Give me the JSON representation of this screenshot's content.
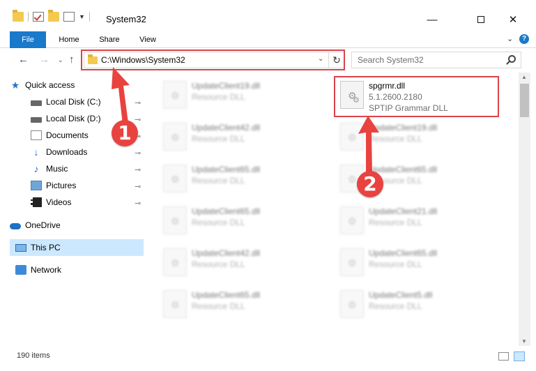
{
  "window": {
    "title": "System32",
    "minimize_glyph": "—",
    "close_glyph": "✕"
  },
  "ribbon": {
    "tabs": [
      "File",
      "Home",
      "Share",
      "View"
    ],
    "expand_glyph": "⌄",
    "help_glyph": "?"
  },
  "address": {
    "path": "C:\\Windows\\System32",
    "dropdown_glyph": "⌄",
    "refresh_glyph": "↻"
  },
  "search": {
    "placeholder": "Search System32"
  },
  "nav": {
    "back_glyph": "←",
    "forward_glyph": "→",
    "recent_glyph": "⌄",
    "up_glyph": "↑"
  },
  "sidebar": {
    "quick_access": "Quick access",
    "items": [
      {
        "label": "Local Disk (C:)",
        "icon": "disk-icon"
      },
      {
        "label": "Local Disk (D:)",
        "icon": "disk-icon"
      },
      {
        "label": "Documents",
        "icon": "documents-icon"
      },
      {
        "label": "Downloads",
        "icon": "download-icon"
      },
      {
        "label": "Music",
        "icon": "music-icon"
      },
      {
        "label": "Pictures",
        "icon": "pictures-icon"
      },
      {
        "label": "Videos",
        "icon": "videos-icon"
      }
    ],
    "onedrive": "OneDrive",
    "this_pc": "This PC",
    "network": "Network",
    "pin_glyph": "📌"
  },
  "files": {
    "highlighted": {
      "name": "spgrmr.dll",
      "version": "5.1.2600.2180",
      "description": "SPTIP Grammar DLL"
    },
    "col1": [
      {
        "name": "UpdateClient19.dll",
        "desc": "Resource DLL"
      },
      {
        "name": "UpdateClient42.dll",
        "desc": "Resource DLL"
      },
      {
        "name": "UpdateClient65.dll",
        "desc": "Resource DLL"
      },
      {
        "name": "UpdateClient65.dll",
        "desc": "Resource DLL"
      },
      {
        "name": "UpdateClient42.dll",
        "desc": "Resource DLL"
      },
      {
        "name": "UpdateClient65.dll",
        "desc": "Resource DLL"
      }
    ],
    "col2": [
      {
        "name": "UpdateClient19.dll",
        "desc": "Resource DLL"
      },
      {
        "name": "UpdateClient65.dll",
        "desc": "Resource DLL"
      },
      {
        "name": "UpdateClient21.dll",
        "desc": "Resource DLL"
      },
      {
        "name": "UpdateClient65.dll",
        "desc": "Resource DLL"
      },
      {
        "name": "UpdateClient5.dll",
        "desc": "Resource DLL"
      }
    ]
  },
  "status": {
    "count": "190 items"
  },
  "annotations": {
    "step1": "1",
    "step2": "2",
    "color": "#e8433f"
  }
}
